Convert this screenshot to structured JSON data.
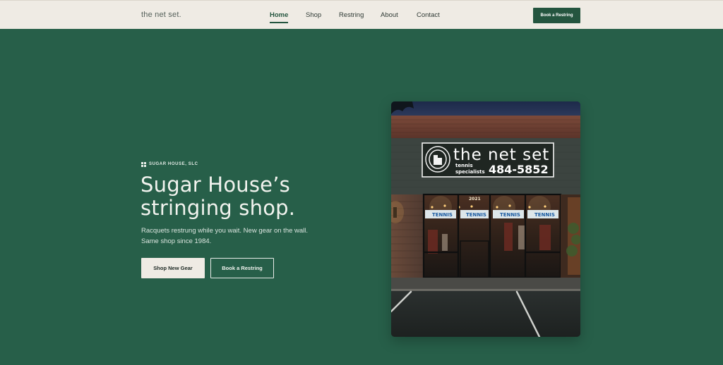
{
  "header": {
    "logo": "the net set.",
    "nav": [
      {
        "label": "Home",
        "active": true
      },
      {
        "label": "Shop",
        "active": false
      },
      {
        "label": "Restring",
        "active": false
      },
      {
        "label": "About",
        "active": false
      },
      {
        "label": "Contact",
        "active": false
      }
    ],
    "cta_label": "Book a Restring"
  },
  "hero": {
    "eyebrow": "SUGAR HOUSE, SLC",
    "eyebrow_icon": "grid-icon",
    "headline_line1": "Sugar House’s",
    "headline_line2": "stringing shop.",
    "subtitle_line1": "Racquets restrung while you wait. New gear on the wall.",
    "subtitle_line2": "Same shop since 1984.",
    "primary_button": "Shop New Gear",
    "secondary_button": "Book a Restring"
  },
  "storefront": {
    "sign_title": "the net set",
    "sign_sub1": "tennis",
    "sign_sub2": "specialists",
    "sign_phone": "484-5852",
    "address_number": "2021",
    "window_banners": [
      "TENNIS",
      "TENNIS",
      "TENNIS",
      "TENNIS"
    ]
  },
  "colors": {
    "brand_green": "#275f49",
    "button_green": "#24553f",
    "cream": "#efebe4"
  }
}
